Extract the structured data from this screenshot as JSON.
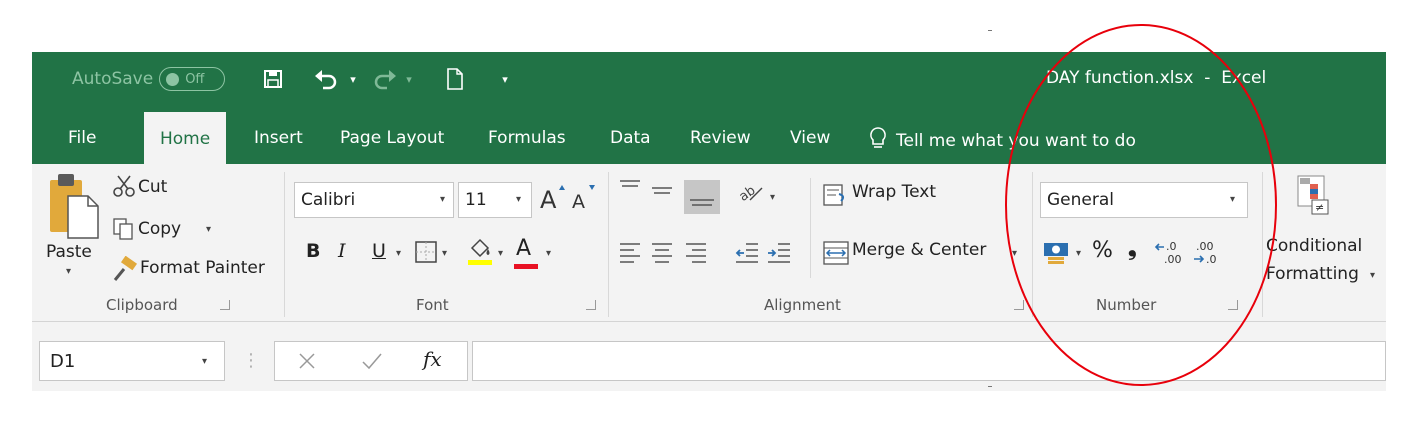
{
  "title_bar": {
    "autosave_label": "AutoSave",
    "autosave_state": "Off",
    "document_title": "DAY function.xlsx  -  Excel",
    "background_color": "#217346",
    "quick_access_icons": [
      "save-icon",
      "undo-icon",
      "redo-icon",
      "new-file-icon",
      "customize-qat-icon"
    ]
  },
  "tabs": {
    "file": "File",
    "home": "Home",
    "insert": "Insert",
    "page_layout": "Page Layout",
    "formulas": "Formulas",
    "data": "Data",
    "review": "Review",
    "view": "View",
    "tell_me": "Tell me what you want to do",
    "active": "Home"
  },
  "clipboard": {
    "paste": "Paste",
    "cut": "Cut",
    "copy": "Copy",
    "format_painter": "Format Painter",
    "group_label": "Clipboard"
  },
  "font": {
    "font_name": "Calibri",
    "font_size": "11",
    "bold": "B",
    "italic": "I",
    "underline": "U",
    "font_color_glyph": "A",
    "font_color": "#e81123",
    "group_label": "Font"
  },
  "alignment": {
    "wrap_text": "Wrap Text",
    "merge_center": "Merge & Center",
    "group_label": "Alignment"
  },
  "number": {
    "format": "General",
    "percent": "%",
    "comma": "❟",
    "increase_decimal": "←.0  .00",
    "decrease_decimal": ".00  →.0",
    "group_label": "Number"
  },
  "styles": {
    "conditional_formatting_line1": "Conditional",
    "conditional_formatting_line2": "Formatting"
  },
  "formula_bar": {
    "name_box": "D1",
    "fx": "fx",
    "formula": ""
  },
  "annotation": {
    "highlight_color": "#e8000b",
    "shape": "ellipse"
  }
}
